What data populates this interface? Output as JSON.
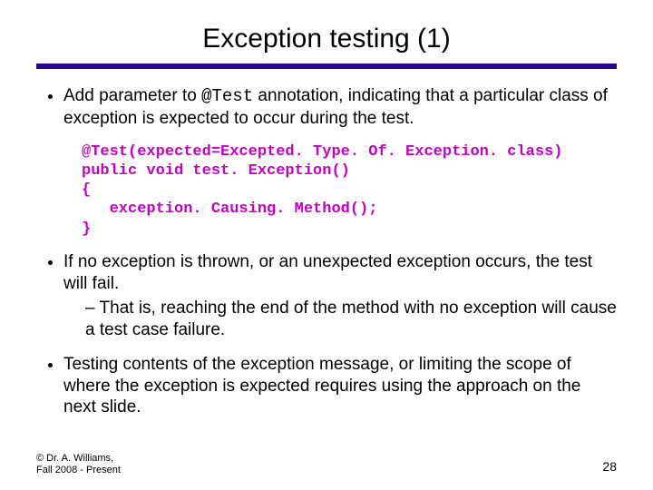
{
  "title": "Exception testing (1)",
  "bullets": {
    "b1_pre": "Add parameter to ",
    "b1_code": "@Test",
    "b1_post": " annotation, indicating that a particular class of exception is expected to occur during the test.",
    "b2": "If no exception is thrown, or an unexpected exception occurs, the test will fail.",
    "b2_sub": "That is, reaching the end of the method with no exception will cause a test case failure.",
    "b3": "Testing contents of the exception message, or limiting the scope of where the exception is expected requires using the approach on the next slide."
  },
  "code": "@Test(expected=Excepted. Type. Of. Exception. class)\npublic void test. Exception()\n{\n   exception. Causing. Method();\n}",
  "footer": {
    "left_line1": "© Dr. A. Williams,",
    "left_line2": "Fall 2008 - Present",
    "page": "28"
  }
}
